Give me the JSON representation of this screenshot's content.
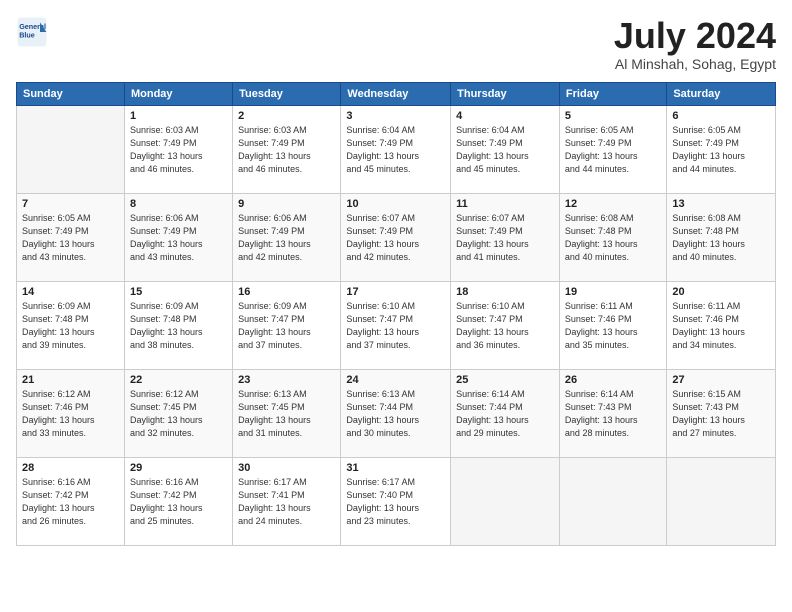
{
  "header": {
    "logo_line1": "General",
    "logo_line2": "Blue",
    "title": "July 2024",
    "subtitle": "Al Minshah, Sohag, Egypt"
  },
  "days_of_week": [
    "Sunday",
    "Monday",
    "Tuesday",
    "Wednesday",
    "Thursday",
    "Friday",
    "Saturday"
  ],
  "weeks": [
    [
      {
        "day": "",
        "info": ""
      },
      {
        "day": "1",
        "info": "Sunrise: 6:03 AM\nSunset: 7:49 PM\nDaylight: 13 hours\nand 46 minutes."
      },
      {
        "day": "2",
        "info": "Sunrise: 6:03 AM\nSunset: 7:49 PM\nDaylight: 13 hours\nand 46 minutes."
      },
      {
        "day": "3",
        "info": "Sunrise: 6:04 AM\nSunset: 7:49 PM\nDaylight: 13 hours\nand 45 minutes."
      },
      {
        "day": "4",
        "info": "Sunrise: 6:04 AM\nSunset: 7:49 PM\nDaylight: 13 hours\nand 45 minutes."
      },
      {
        "day": "5",
        "info": "Sunrise: 6:05 AM\nSunset: 7:49 PM\nDaylight: 13 hours\nand 44 minutes."
      },
      {
        "day": "6",
        "info": "Sunrise: 6:05 AM\nSunset: 7:49 PM\nDaylight: 13 hours\nand 44 minutes."
      }
    ],
    [
      {
        "day": "7",
        "info": "Sunrise: 6:05 AM\nSunset: 7:49 PM\nDaylight: 13 hours\nand 43 minutes."
      },
      {
        "day": "8",
        "info": "Sunrise: 6:06 AM\nSunset: 7:49 PM\nDaylight: 13 hours\nand 43 minutes."
      },
      {
        "day": "9",
        "info": "Sunrise: 6:06 AM\nSunset: 7:49 PM\nDaylight: 13 hours\nand 42 minutes."
      },
      {
        "day": "10",
        "info": "Sunrise: 6:07 AM\nSunset: 7:49 PM\nDaylight: 13 hours\nand 42 minutes."
      },
      {
        "day": "11",
        "info": "Sunrise: 6:07 AM\nSunset: 7:49 PM\nDaylight: 13 hours\nand 41 minutes."
      },
      {
        "day": "12",
        "info": "Sunrise: 6:08 AM\nSunset: 7:48 PM\nDaylight: 13 hours\nand 40 minutes."
      },
      {
        "day": "13",
        "info": "Sunrise: 6:08 AM\nSunset: 7:48 PM\nDaylight: 13 hours\nand 40 minutes."
      }
    ],
    [
      {
        "day": "14",
        "info": "Sunrise: 6:09 AM\nSunset: 7:48 PM\nDaylight: 13 hours\nand 39 minutes."
      },
      {
        "day": "15",
        "info": "Sunrise: 6:09 AM\nSunset: 7:48 PM\nDaylight: 13 hours\nand 38 minutes."
      },
      {
        "day": "16",
        "info": "Sunrise: 6:09 AM\nSunset: 7:47 PM\nDaylight: 13 hours\nand 37 minutes."
      },
      {
        "day": "17",
        "info": "Sunrise: 6:10 AM\nSunset: 7:47 PM\nDaylight: 13 hours\nand 37 minutes."
      },
      {
        "day": "18",
        "info": "Sunrise: 6:10 AM\nSunset: 7:47 PM\nDaylight: 13 hours\nand 36 minutes."
      },
      {
        "day": "19",
        "info": "Sunrise: 6:11 AM\nSunset: 7:46 PM\nDaylight: 13 hours\nand 35 minutes."
      },
      {
        "day": "20",
        "info": "Sunrise: 6:11 AM\nSunset: 7:46 PM\nDaylight: 13 hours\nand 34 minutes."
      }
    ],
    [
      {
        "day": "21",
        "info": "Sunrise: 6:12 AM\nSunset: 7:46 PM\nDaylight: 13 hours\nand 33 minutes."
      },
      {
        "day": "22",
        "info": "Sunrise: 6:12 AM\nSunset: 7:45 PM\nDaylight: 13 hours\nand 32 minutes."
      },
      {
        "day": "23",
        "info": "Sunrise: 6:13 AM\nSunset: 7:45 PM\nDaylight: 13 hours\nand 31 minutes."
      },
      {
        "day": "24",
        "info": "Sunrise: 6:13 AM\nSunset: 7:44 PM\nDaylight: 13 hours\nand 30 minutes."
      },
      {
        "day": "25",
        "info": "Sunrise: 6:14 AM\nSunset: 7:44 PM\nDaylight: 13 hours\nand 29 minutes."
      },
      {
        "day": "26",
        "info": "Sunrise: 6:14 AM\nSunset: 7:43 PM\nDaylight: 13 hours\nand 28 minutes."
      },
      {
        "day": "27",
        "info": "Sunrise: 6:15 AM\nSunset: 7:43 PM\nDaylight: 13 hours\nand 27 minutes."
      }
    ],
    [
      {
        "day": "28",
        "info": "Sunrise: 6:16 AM\nSunset: 7:42 PM\nDaylight: 13 hours\nand 26 minutes."
      },
      {
        "day": "29",
        "info": "Sunrise: 6:16 AM\nSunset: 7:42 PM\nDaylight: 13 hours\nand 25 minutes."
      },
      {
        "day": "30",
        "info": "Sunrise: 6:17 AM\nSunset: 7:41 PM\nDaylight: 13 hours\nand 24 minutes."
      },
      {
        "day": "31",
        "info": "Sunrise: 6:17 AM\nSunset: 7:40 PM\nDaylight: 13 hours\nand 23 minutes."
      },
      {
        "day": "",
        "info": ""
      },
      {
        "day": "",
        "info": ""
      },
      {
        "day": "",
        "info": ""
      }
    ]
  ]
}
